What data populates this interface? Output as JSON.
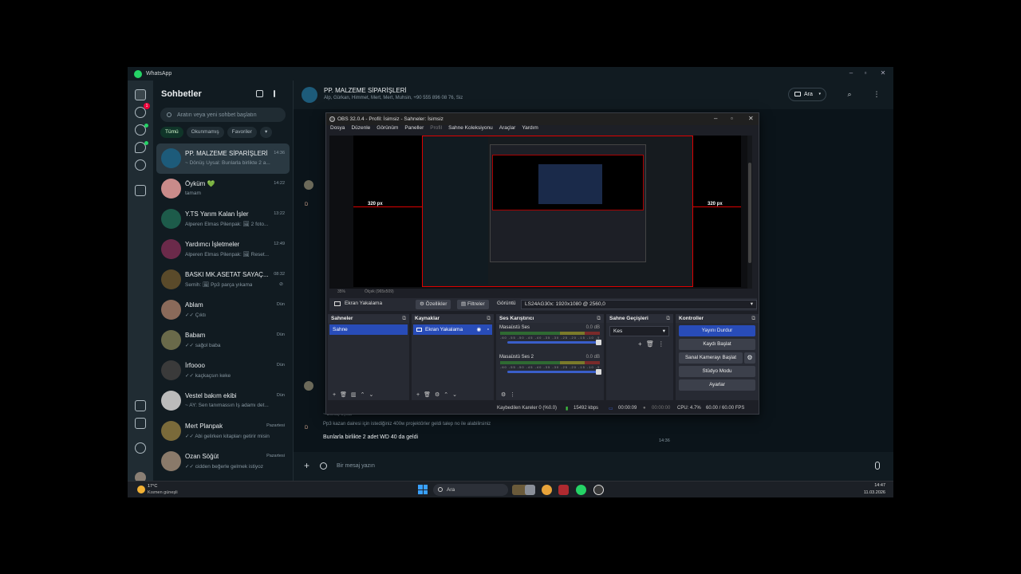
{
  "app": {
    "title": "WhatsApp"
  },
  "chatlist": {
    "title": "Sohbetler",
    "search_placeholder": "Aratın veya yeni sohbet başlatın",
    "filters": [
      "Tümü",
      "Okunmamış",
      "Favoriler"
    ],
    "unread_badge": "1",
    "chats": [
      {
        "name": "PP. MALZEME SİPARİŞLERİ",
        "time": "14:36",
        "preview": "~ Dönüş Uysal: Bunlarla birlikte 2 a...",
        "avatar_color": "#1d5b7a"
      },
      {
        "name": "Öyküm 💚",
        "time": "14:22",
        "preview": "tamam",
        "avatar_color": "#c98b8a"
      },
      {
        "name": "Y.TS Yarım Kalan İşler",
        "time": "13:22",
        "preview": "Alperen Elmas Pilenpak: 🖼 2 foto...",
        "avatar_color": "#1d5b4a"
      },
      {
        "name": "Yardımcı İşletmeler",
        "time": "12:49",
        "preview": "Alperen Elmas Pilenpak: 🖼 Reset...",
        "avatar_color": "#6b2a4a"
      },
      {
        "name": "BASKI MK.ASETAT SAYAÇ...",
        "time": "08:32",
        "preview": "Semih: 🖼 Pp3 parça yıkama",
        "avatar_color": "#5a4a2a"
      },
      {
        "name": "Ablam",
        "time": "Dün",
        "preview": "✓✓ Çıktı",
        "avatar_color": "#8a6a5a"
      },
      {
        "name": "Babam",
        "time": "Dün",
        "preview": "✓✓ sağol baba",
        "avatar_color": "#6a6a4a"
      },
      {
        "name": "İrfoooo",
        "time": "Dün",
        "preview": "✓✓ kaçkaçsın keke",
        "avatar_color": "#3a3a3a"
      },
      {
        "name": "Vestel bakım ekibi",
        "time": "Dün",
        "preview": "~ AY: Sen tanımassın İş adamı det...",
        "avatar_color": "#bbbbbb"
      },
      {
        "name": "Mert Planpak",
        "time": "Pazartesi",
        "preview": "✓✓ Abi gelirken kitapları getirir misin",
        "avatar_color": "#7a6a3a"
      },
      {
        "name": "Ozan Söğüt",
        "time": "Pazartesi",
        "preview": "✓✓ cidden beğerle gelmek istiyoz",
        "avatar_color": "#8a7a6a"
      }
    ]
  },
  "conversation": {
    "name": "PP. MALZEME SİPARİŞLERİ",
    "members": "Alp, Gürkan, Himmet, Mert, Mert, Muhsin, +90 555 896 08 76, Siz",
    "call_label": "Ara",
    "quote_sender": "~ Dönüş Uysal",
    "quote_text": "Pp3 kazan dairesi için istediğiniz 400w projektörler geldi talep no ile alabilirsiniz",
    "last_message": "Bunlarla birlikte 2 adet WD 40 da geldi",
    "last_time": "14:36",
    "composer_placeholder": "Bir mesaj yazın",
    "sender_initial": "D"
  },
  "obs": {
    "title": "OBS 32.0.4 - Profil: İsimsiz - Sahneler: İsimsiz",
    "menu": [
      "Dosya",
      "Düzenle",
      "Görünüm",
      "Paneller",
      "Profil",
      "Sahne Koleksiyonu",
      "Araçlar",
      "Yardım"
    ],
    "left_px": "320 px",
    "right_px": "320 px",
    "zoom": "35%",
    "zoom_label": "Ölçek (965x509)",
    "source_name": "Ekran Yakalama",
    "btn_properties": "Özellikler",
    "btn_filters": "Filtreler",
    "display_label": "Görüntü",
    "display_value": "LS24AG30x: 1920x1080 @ 2560,0",
    "docks": {
      "scenes": {
        "title": "Sahneler",
        "item": "Sahne"
      },
      "sources": {
        "title": "Kaynaklar",
        "item": "Ekran Yakalama"
      },
      "mixer": {
        "title": "Ses Karıştırıcı",
        "ch1": "Masaüstü Ses",
        "ch1_db": "0.0 dB",
        "ch2": "Masaüstü Ses 2",
        "ch2_db": "0.0 dB",
        "scale": "-60 -55 -50 -45 -40 -35 -30 -25 -20 -15 -10 -5 0"
      },
      "transitions": {
        "title": "Sahne Geçişleri",
        "value": "Kes"
      },
      "controls": {
        "title": "Kontroller",
        "buttons": [
          "Yayını Durdur",
          "Kaydı Başlat",
          "Sanal Kamerayı Başlat",
          "Stüdyo Modu",
          "Ayarlar"
        ]
      }
    },
    "status": {
      "dropped": "Kaybedilen Kareler 0 (%0.0)",
      "bitrate": "15492 kbps",
      "stream_time": "00:00:09",
      "rec_time": "00:00:00",
      "cpu": "CPU: 4.7%",
      "fps": "60.00 / 60.00 FPS"
    }
  },
  "taskbar": {
    "temp": "17°C",
    "condition": "Kısmen güneşli",
    "search": "Ara",
    "time": "14:47",
    "date": "11.03.2026"
  },
  "colors": {
    "accent": "#25d366",
    "obs_blue": "#284cb8",
    "bg": "#0b141a"
  }
}
